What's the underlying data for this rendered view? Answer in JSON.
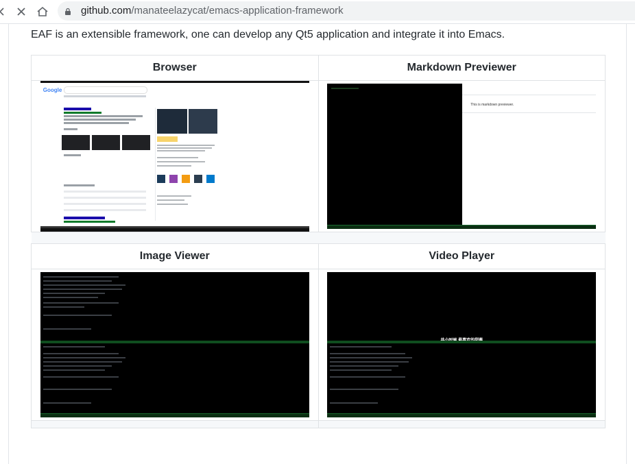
{
  "browser": {
    "url_host": "github.com",
    "url_path": "/manateelazycat/emacs-application-framework"
  },
  "intro_text": "EAF is an extensible framework, one can develop any Qt5 application and integrate it into Emacs.",
  "gallery": {
    "cells": [
      {
        "title": "Browser"
      },
      {
        "title": "Markdown Previewer"
      },
      {
        "title": "Image Viewer"
      },
      {
        "title": "Video Player"
      }
    ]
  },
  "screens": {
    "browser_logo": "Google",
    "browser_query": "emacs",
    "browser_panel_title": "Emacs",
    "markdown_text": "This is markdown previewer.",
    "video_subtitle": "井小时候 最喜欢的甜酱"
  },
  "colors": {
    "link": "#1a0dab",
    "border": "#dfe2e5",
    "terminal_bg": "#000000"
  }
}
